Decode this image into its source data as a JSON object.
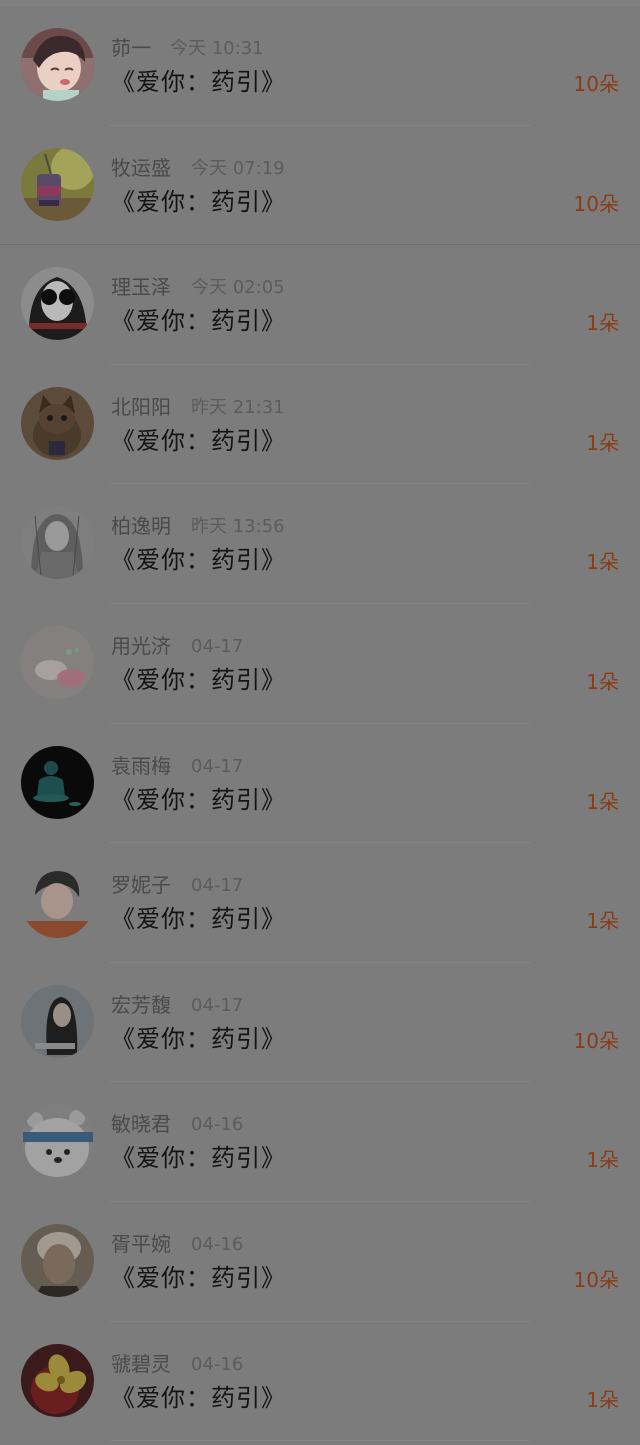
{
  "colors": {
    "overlay_background": "#7c7c7c",
    "count_accent": "#8a3c16"
  },
  "gifts": [
    {
      "name": "茆一",
      "time": "今天 10:31",
      "title": "《爱你：药引》",
      "count": "10朵",
      "avatar": "anime-girl-avatar"
    },
    {
      "name": "牧运盛",
      "time": "今天 07:19",
      "title": "《爱你：药引》",
      "count": "10朵",
      "avatar": "drink-jar-avatar"
    },
    {
      "name": "理玉泽",
      "time": "今天 02:05",
      "title": "《爱你：药引》",
      "count": "1朵",
      "avatar": "sunglasses-person-avatar"
    },
    {
      "name": "北阳阳",
      "time": "昨天 21:31",
      "title": "《爱你：药引》",
      "count": "1朵",
      "avatar": "kitten-avatar"
    },
    {
      "name": "柏逸明",
      "time": "昨天 13:56",
      "title": "《爱你：药引》",
      "count": "1朵",
      "avatar": "sketch-portrait-avatar"
    },
    {
      "name": "用光济",
      "time": "04-17",
      "title": "《爱你：药引》",
      "count": "1朵",
      "avatar": "sleeping-cartoon-avatar"
    },
    {
      "name": "袁雨梅",
      "time": "04-17",
      "title": "《爱你：药引》",
      "count": "1朵",
      "avatar": "buddha-statue-avatar"
    },
    {
      "name": "罗妮子",
      "time": "04-17",
      "title": "《爱你：药引》",
      "count": "1朵",
      "avatar": "young-man-avatar"
    },
    {
      "name": "宏芳馥",
      "time": "04-17",
      "title": "《爱你：药引》",
      "count": "10朵",
      "avatar": "long-hair-woman-avatar"
    },
    {
      "name": "敏晓君",
      "time": "04-16",
      "title": "《爱你：药引》",
      "count": "1朵",
      "avatar": "cartoon-bear-avatar"
    },
    {
      "name": "胥平婉",
      "time": "04-16",
      "title": "《爱你：药引》",
      "count": "10朵",
      "avatar": "elder-portrait-avatar"
    },
    {
      "name": "虢碧灵",
      "time": "04-16",
      "title": "《爱你：药引》",
      "count": "1朵",
      "avatar": "flower-fruit-avatar"
    }
  ]
}
